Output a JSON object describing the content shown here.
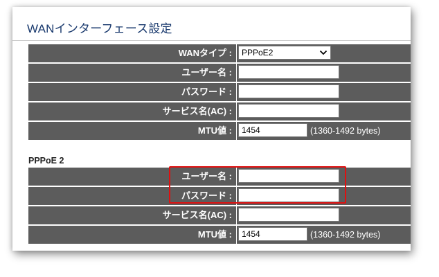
{
  "page_title": "WANインターフェース設定",
  "wan_section": {
    "wan_type_label": "WANタイプ :",
    "wan_type_value": "PPPoE2",
    "username_label": "ユーザー名 :",
    "username_value": "",
    "password_label": "パスワード :",
    "password_value": "",
    "service_name_label": "サービス名(AC) :",
    "service_name_value": "",
    "mtu_label": "MTU値 :",
    "mtu_value": "1454",
    "mtu_range": "(1360-1492 bytes)"
  },
  "pppoe2_section": {
    "heading": "PPPoE 2",
    "username_label": "ユーザー名 :",
    "username_value": "",
    "password_label": "パスワード :",
    "password_value": "",
    "service_name_label": "サービス名(AC) :",
    "service_name_value": "",
    "mtu_label": "MTU値 :",
    "mtu_value": "1454",
    "mtu_range": "(1360-1492 bytes)"
  },
  "icons": {
    "dropdown": "chevron-down-icon"
  },
  "colors": {
    "label_bg": "#5c5c5c",
    "title_text": "#1a3a6e",
    "highlight_box": "#e01010"
  }
}
